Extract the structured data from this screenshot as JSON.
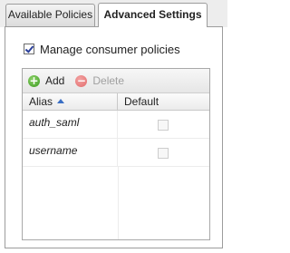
{
  "tabs": {
    "available_label": "Available Policies",
    "advanced_label": "Advanced Settings",
    "active": "Advanced Settings"
  },
  "settings": {
    "manage_label": "Manage consumer policies",
    "manage_checked": true
  },
  "toolbar": {
    "add_label": "Add",
    "delete_label": "Delete",
    "add_icon": "plus-circle-icon",
    "delete_icon": "minus-circle-icon",
    "delete_enabled": false
  },
  "grid": {
    "columns": [
      {
        "label": "Alias",
        "sorted": "ascending"
      },
      {
        "label": "Default"
      }
    ],
    "rows": [
      {
        "alias": "auth_saml",
        "default": false
      },
      {
        "alias": "username",
        "default": false
      }
    ]
  },
  "colors": {
    "accent_green": "#3a9a1e",
    "accent_red": "#e26a6a",
    "sort_arrow": "#3a6fc4",
    "border": "#9c9c9c"
  }
}
